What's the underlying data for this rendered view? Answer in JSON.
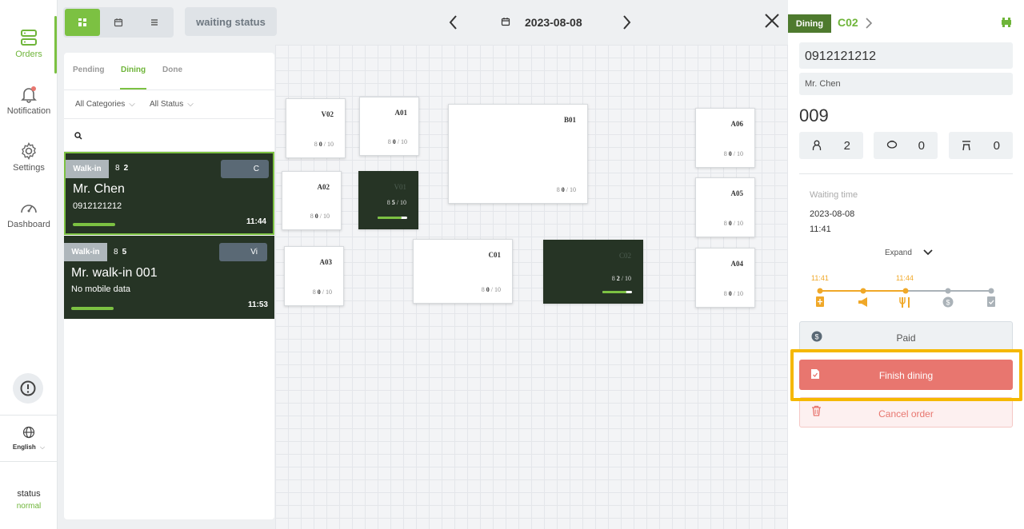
{
  "nav": {
    "items": [
      {
        "label": "Orders",
        "icon": "server-icon"
      },
      {
        "label": "Notification",
        "icon": "bell-icon"
      },
      {
        "label": "Settings",
        "icon": "gear-icon"
      },
      {
        "label": "Dashboard",
        "icon": "speedometer-icon"
      }
    ],
    "language": "English",
    "status_label": "status",
    "status_value": "normal"
  },
  "toolbar": {
    "waiting_status": "waiting status",
    "date": "2023-08-08"
  },
  "orders_panel": {
    "tabs": [
      "Pending",
      "Dining",
      "Done"
    ],
    "active_tab": "Dining",
    "filter_category": "All Categories",
    "filter_status": "All Status",
    "orders": [
      {
        "tag": "Walk-in",
        "people": "2",
        "table_btn": "C",
        "name": "Mr. Chen",
        "phone": "0912121212",
        "time": "11:44"
      },
      {
        "tag": "Walk-in",
        "people": "5",
        "table_btn": "Vi",
        "name": "Mr. walk-in 001",
        "phone": "No mobile data",
        "time": "11:53"
      }
    ]
  },
  "floor": {
    "tables": [
      {
        "name": "V02",
        "seated": "0",
        "cap": "/ 10"
      },
      {
        "name": "A01",
        "seated": "0",
        "cap": "/ 10"
      },
      {
        "name": "B01",
        "seated": "0",
        "cap": "/ 10"
      },
      {
        "name": "A06",
        "seated": "0",
        "cap": "/ 10"
      },
      {
        "name": "A02",
        "seated": "0",
        "cap": "/ 10"
      },
      {
        "name": "V01",
        "seated": "5",
        "cap": "/ 10"
      },
      {
        "name": "A05",
        "seated": "0",
        "cap": "/ 10"
      },
      {
        "name": "A03",
        "seated": "0",
        "cap": "/ 10"
      },
      {
        "name": "C01",
        "seated": "0",
        "cap": "/ 10"
      },
      {
        "name": "C02",
        "seated": "2",
        "cap": "/ 10"
      },
      {
        "name": "A04",
        "seated": "0",
        "cap": "/ 10"
      }
    ]
  },
  "detail": {
    "tag": "Dining",
    "table": "C02",
    "phone": "0912121212",
    "name": "Mr. Chen",
    "order_number": "009",
    "adults": "2",
    "kids": "0",
    "high_chairs": "0",
    "waiting_time_label": "Waiting time",
    "waiting_date": "2023-08-08",
    "waiting_time": "11:41",
    "expand_label": "Expand",
    "timeline_time_1": "11:41",
    "timeline_time_2": "11:44",
    "paid_label": "Paid",
    "finish_label": "Finish dining",
    "cancel_label": "Cancel order"
  },
  "colors": {
    "accent": "#7cc142",
    "dark": "#263425",
    "danger": "#e8766f",
    "timeline": "#f0a828",
    "highlight": "#f5b800"
  }
}
